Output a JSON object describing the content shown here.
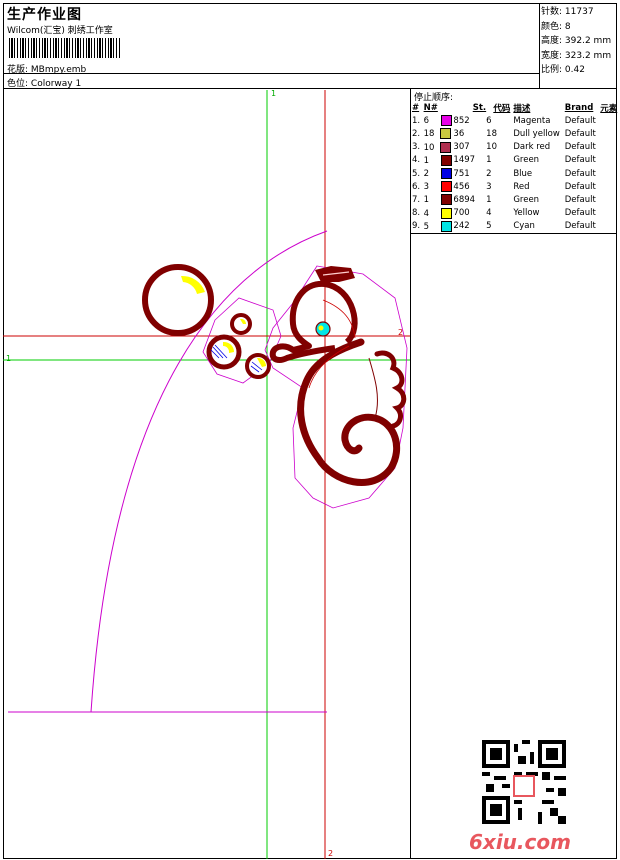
{
  "header": {
    "title": "生产作业图",
    "subtitle": "Wilcom(汇宝) 刺绣工作室",
    "design_label": "花版:",
    "design_value": "MBmpy.emb",
    "colorway_label": "色位:",
    "colorway_value": "Colorway 1"
  },
  "stats": {
    "stitches_label": "针数:",
    "stitches_value": "11737",
    "colors_label": "颜色:",
    "colors_value": "8",
    "height_label": "高度:",
    "height_value": "392.2 mm",
    "width_label": "宽度:",
    "width_value": "323.2 mm",
    "scale_label": "比例:",
    "scale_value": "0.42"
  },
  "stop_sequence": {
    "title": "停止顺序:",
    "headers": [
      "#",
      "N#",
      "St.",
      "代码",
      "描述",
      "Brand",
      "元素"
    ],
    "rows": [
      {
        "idx": "1.",
        "n": "6",
        "color": "#e600e6",
        "st": "852",
        "code": "6",
        "desc": "Magenta",
        "brand": "Default"
      },
      {
        "idx": "2.",
        "n": "18",
        "color": "#c8c840",
        "st": "36",
        "code": "18",
        "desc": "Dull yellow",
        "brand": "Default"
      },
      {
        "idx": "3.",
        "n": "10",
        "color": "#b03050",
        "st": "307",
        "code": "10",
        "desc": "Dark red",
        "brand": "Default"
      },
      {
        "idx": "4.",
        "n": "1",
        "color": "#800000",
        "st": "1497",
        "code": "1",
        "desc": "Green",
        "brand": "Default"
      },
      {
        "idx": "5.",
        "n": "2",
        "color": "#0000e6",
        "st": "751",
        "code": "2",
        "desc": "Blue",
        "brand": "Default"
      },
      {
        "idx": "6.",
        "n": "3",
        "color": "#ff0000",
        "st": "456",
        "code": "3",
        "desc": "Red",
        "brand": "Default"
      },
      {
        "idx": "7.",
        "n": "1",
        "color": "#800000",
        "st": "6894",
        "code": "1",
        "desc": "Green",
        "brand": "Default"
      },
      {
        "idx": "8.",
        "n": "4",
        "color": "#ffff00",
        "st": "700",
        "code": "4",
        "desc": "Yellow",
        "brand": "Default"
      },
      {
        "idx": "9.",
        "n": "5",
        "color": "#00e6e6",
        "st": "242",
        "code": "5",
        "desc": "Cyan",
        "brand": "Default"
      }
    ]
  },
  "axes": {
    "green_label_top": "1",
    "green_label_left": "1",
    "red_label_right": "2",
    "red_label_bottom": "2"
  },
  "watermark": {
    "text": "6xiu.com"
  },
  "colors": {
    "thread_main": "#800000",
    "guide_green": "#00cc00",
    "guide_red": "#cc0000",
    "outline_magenta": "#cc00cc"
  }
}
